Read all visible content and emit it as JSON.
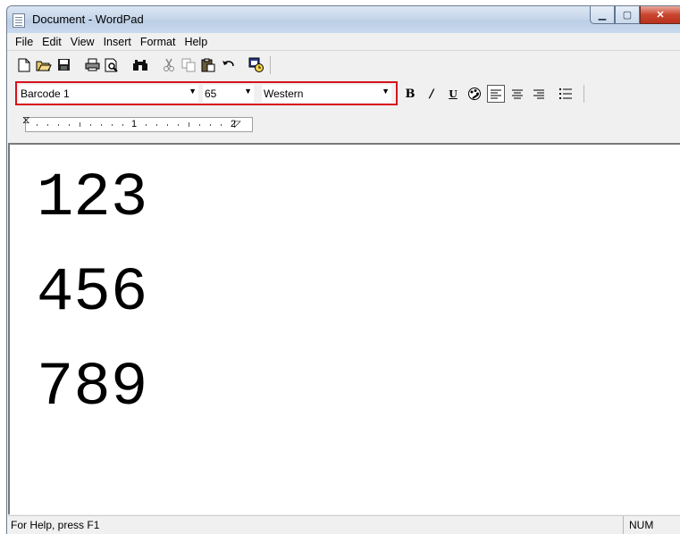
{
  "window": {
    "title": "Document - WordPad"
  },
  "menu": [
    "File",
    "Edit",
    "View",
    "Insert",
    "Format",
    "Help"
  ],
  "format_bar": {
    "font_name": "Barcode 1",
    "font_size": "65",
    "script": "Western"
  },
  "ruler": {
    "mark_1": "1",
    "mark_2": "2"
  },
  "document": {
    "lines": [
      "123",
      "456",
      "789"
    ]
  },
  "status": {
    "help_text": "For Help, press F1",
    "num_indicator": "NUM"
  }
}
